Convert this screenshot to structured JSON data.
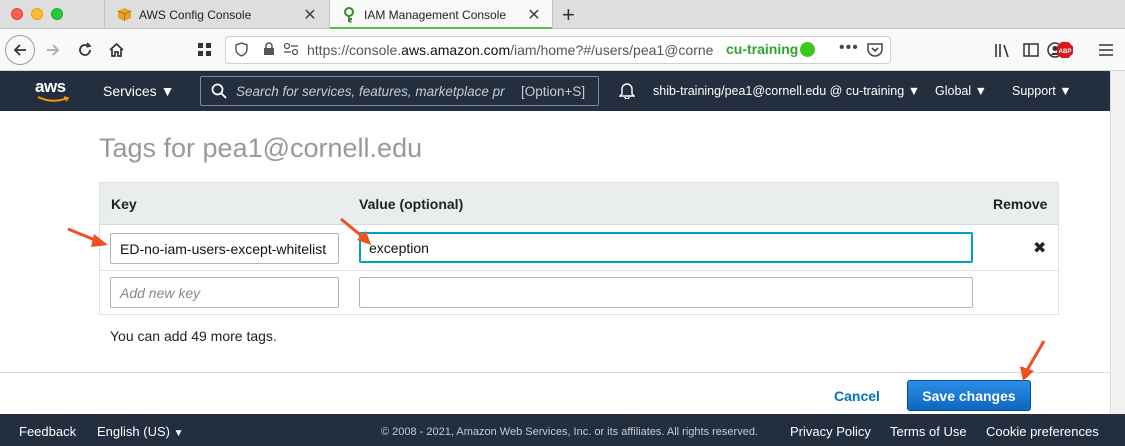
{
  "browser": {
    "tabs": [
      {
        "title": "AWS Config Console",
        "icon": "aws-box-icon"
      },
      {
        "title": "IAM Management Console",
        "icon": "iam-key-icon",
        "active": true
      }
    ],
    "url": {
      "prefix": "https://console.",
      "domain": "aws.amazon.com",
      "path": "/iam/home?#/users/pea1@corne"
    },
    "container_label": "cu-training",
    "colors": {
      "container": "#3cc91b",
      "tab_underline": "#5ac23a"
    }
  },
  "aws_nav": {
    "logo": "aws",
    "services": "Services",
    "search_placeholder": "Search for services, features, marketplace pr",
    "search_shortcut": "[Option+S]",
    "account": "shib-training/pea1@cornell.edu @ cu-training",
    "region": "Global",
    "support": "Support"
  },
  "main": {
    "title": "Tags for pea1@cornell.edu",
    "columns": {
      "key": "Key",
      "value": "Value (optional)",
      "remove": "Remove"
    },
    "rows": [
      {
        "key": "ED-no-iam-users-except-whitelist",
        "value": "exception"
      }
    ],
    "new_key_placeholder": "Add new key",
    "tag_count_text": "You can add 49 more tags.",
    "cancel_label": "Cancel",
    "save_label": "Save changes",
    "colors": {
      "save_button": "#0c6bd0",
      "link": "#0073bb",
      "annotation_arrow": "#f0501e"
    }
  },
  "footer": {
    "feedback": "Feedback",
    "language": "English (US)",
    "copyright": "© 2008 - 2021, Amazon Web Services, Inc. or its affiliates. All rights reserved.",
    "privacy": "Privacy Policy",
    "terms": "Terms of Use",
    "cookies": "Cookie preferences"
  }
}
